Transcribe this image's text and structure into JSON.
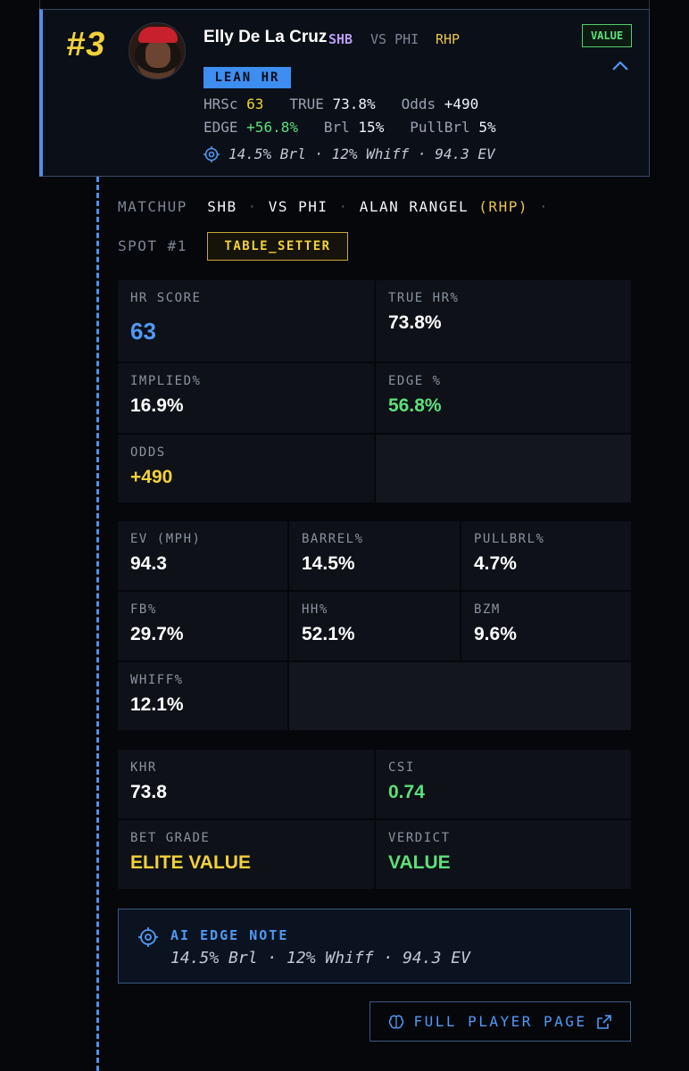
{
  "player": {
    "rank": "#3",
    "name": "Elly De La Cruz",
    "team": "SHB",
    "vs": "VS PHI",
    "hand": "RHP",
    "badge": "VALUE",
    "lean": "LEAN HR",
    "row1": {
      "hrsc_label": "HRSc",
      "hrsc": "63",
      "true_label": "TRUE",
      "true": "73.8%",
      "odds_label": "Odds",
      "odds": "+490"
    },
    "row2": {
      "edge_label": "EDGE",
      "edge": "+56.8%",
      "brl_label": "Brl",
      "brl": "15%",
      "pull_label": "PullBrl",
      "pull": "5%"
    },
    "note": "14.5% Brl · 12% Whiff · 94.3 EV"
  },
  "matchup": {
    "label": "MATCHUP",
    "team": "SHB",
    "vs": "VS PHI",
    "pitcher": "ALAN RANGEL",
    "hand": "(RHP)",
    "sep": "·",
    "spot": "SPOT #1",
    "tag": "TABLE_SETTER"
  },
  "metrics_main": [
    {
      "label": "HR SCORE",
      "value": "63"
    },
    {
      "label": "TRUE HR%",
      "value": "73.8%"
    },
    {
      "label": "IMPLIED%",
      "value": "16.9%"
    },
    {
      "label": "EDGE %",
      "value": "56.8%"
    },
    {
      "label": "ODDS",
      "value": "+490"
    }
  ],
  "metrics_stat": [
    {
      "label": "EV (MPH)",
      "value": "94.3"
    },
    {
      "label": "BARREL%",
      "value": "14.5%"
    },
    {
      "label": "PULLBRL%",
      "value": "4.7%"
    },
    {
      "label": "FB%",
      "value": "29.7%"
    },
    {
      "label": "HH%",
      "value": "52.1%"
    },
    {
      "label": "BZM",
      "value": "9.6%"
    },
    {
      "label": "WHIFF%",
      "value": "12.1%"
    }
  ],
  "metrics_grade": [
    {
      "label": "KHR",
      "value": "73.8"
    },
    {
      "label": "CSI",
      "value": "0.74"
    },
    {
      "label": "BET GRADE",
      "value": "ELITE VALUE"
    },
    {
      "label": "VERDICT",
      "value": "VALUE"
    }
  ],
  "ai_note": {
    "title": "AI EDGE NOTE",
    "text": "14.5% Brl · 12% Whiff · 94.3 EV"
  },
  "full_page_button": "FULL PLAYER PAGE",
  "icons": {
    "avatar": "player-photo",
    "chevron": "chevron-up-icon",
    "target": "target-icon",
    "brain": "brain-icon",
    "external": "external-link-icon"
  },
  "colors": {
    "accent_blue": "#4f8fe8",
    "value_green": "#5be07a",
    "highlight_yellow": "#f2d13a",
    "team_purple": "#b99cf2",
    "background": "#05070b"
  }
}
